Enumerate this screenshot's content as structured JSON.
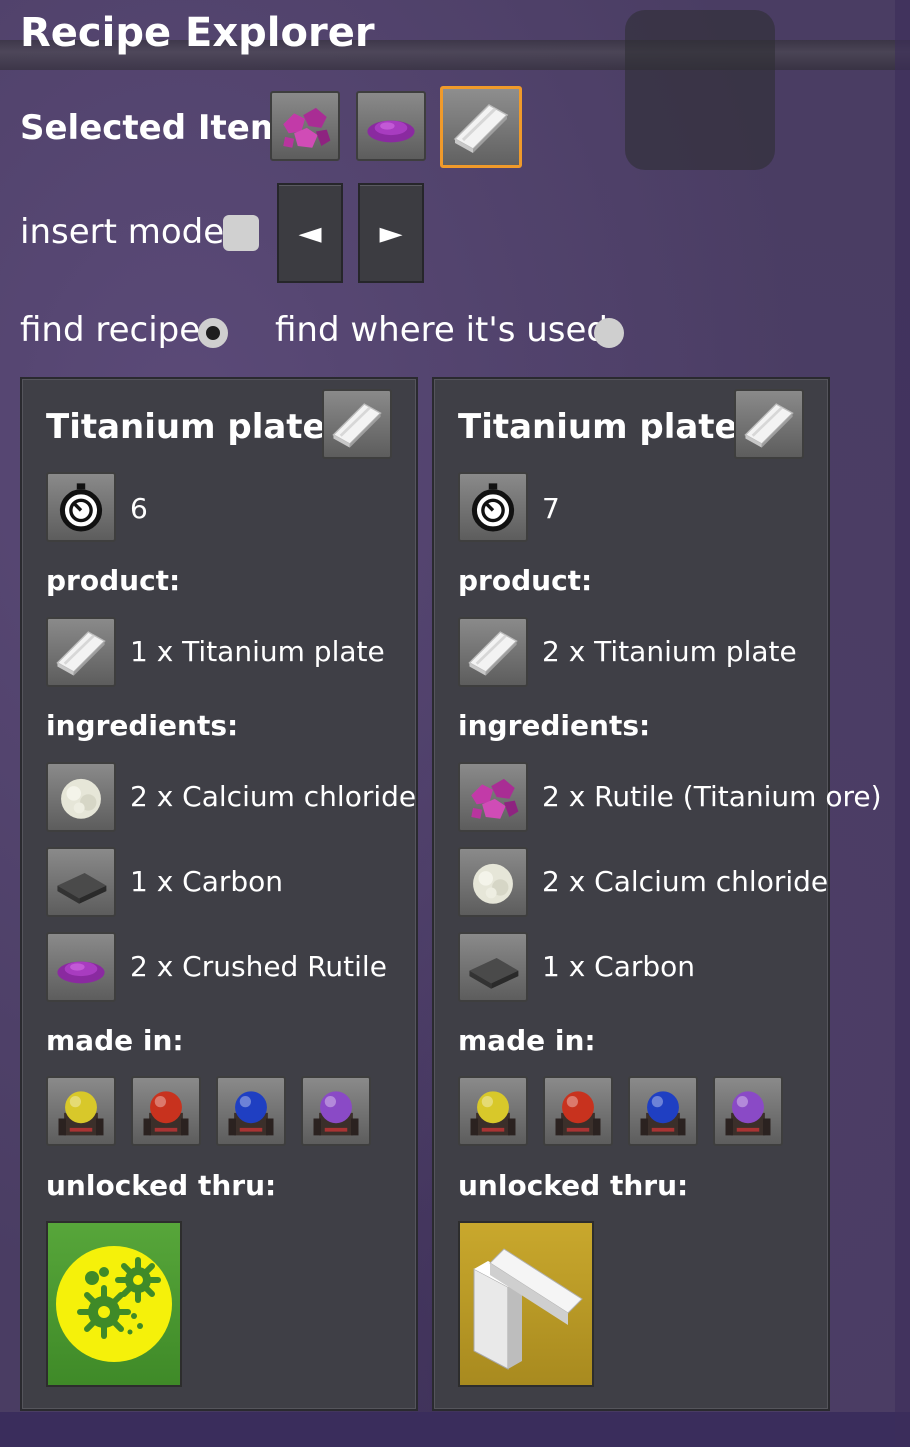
{
  "window": {
    "title": "Recipe Explorer"
  },
  "selected_item": {
    "label": "Selected Item",
    "items": [
      {
        "icon": "rutile-ore-icon"
      },
      {
        "icon": "crushed-rutile-icon"
      },
      {
        "icon": "titanium-plate-icon",
        "selected": true
      }
    ]
  },
  "insert_mode": {
    "label": "insert mode",
    "checked": false,
    "prev_glyph": "◄",
    "next_glyph": "►"
  },
  "modes": {
    "find_recipe": "find recipe",
    "find_used": "find where it's used",
    "find_recipe_selected": true
  },
  "sections": {
    "product": "product:",
    "ingredients": "ingredients:",
    "made_in": "made in:",
    "unlocked": "unlocked thru:"
  },
  "recipes": [
    {
      "title": "Titanium plate:",
      "time": "6",
      "product": "1 x Titanium plate",
      "ingredients": [
        "2 x Calcium chloride",
        "1 x Carbon",
        "2 x Crushed Rutile"
      ],
      "made_in": [
        "yellow-furnace-icon",
        "red-furnace-icon",
        "blue-furnace-icon",
        "purple-furnace-icon"
      ],
      "tech_icon": "gears-technology-icon"
    },
    {
      "title": "Titanium plate:",
      "time": "7",
      "product": "2 x Titanium plate",
      "ingredients": [
        "2 x Rutile (Titanium ore)",
        "2 x Calcium chloride",
        "1 x Carbon"
      ],
      "made_in": [
        "yellow-furnace-icon",
        "red-furnace-icon",
        "blue-furnace-icon",
        "purple-furnace-icon"
      ],
      "tech_icon": "titanium-plate-technology-icon"
    }
  ],
  "colors": {
    "selected_border": "#f09a2a",
    "panel_bg": "#3f3f46",
    "tech_green": "#4f9a33",
    "tech_gold": "#c4a22b"
  }
}
